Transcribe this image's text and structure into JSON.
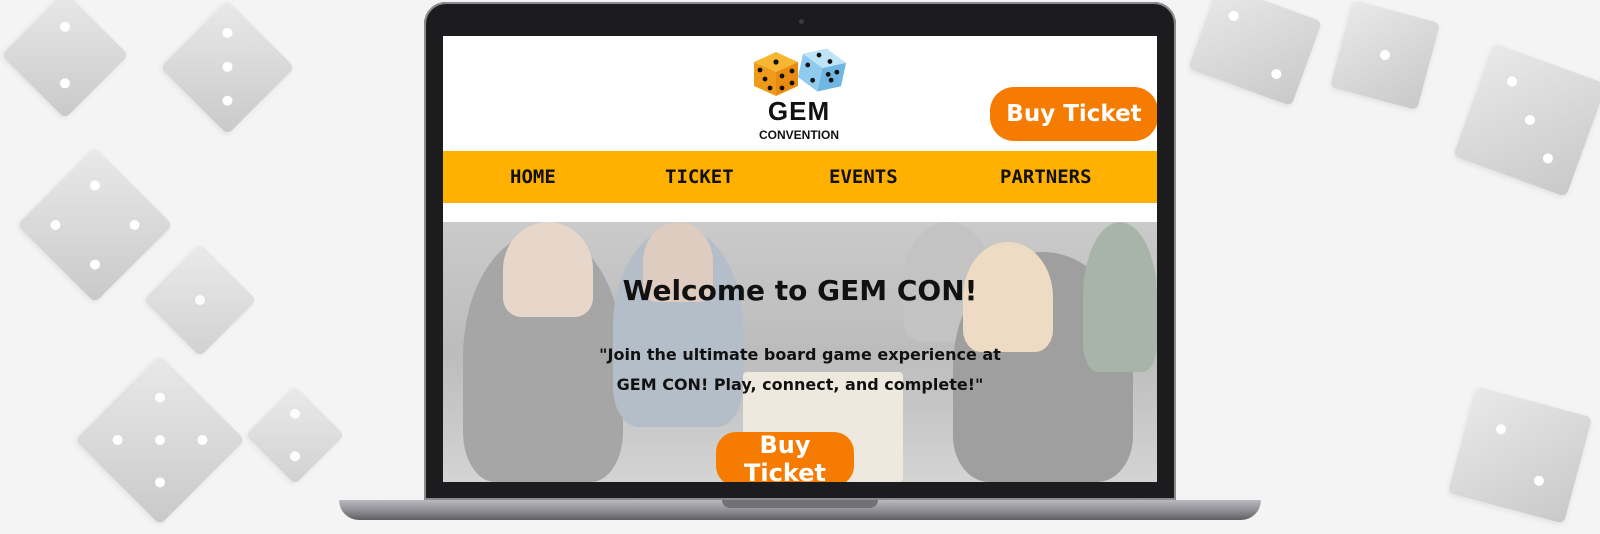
{
  "site": {
    "logo_title": "GEM",
    "logo_subtitle": "CONVENTION"
  },
  "header": {
    "buy_button_label": "Buy Ticket"
  },
  "nav": {
    "items": [
      {
        "label": "HOME"
      },
      {
        "label": "TICKET"
      },
      {
        "label": "EVENTS"
      },
      {
        "label": "PARTNERS"
      }
    ]
  },
  "hero": {
    "title": "Welcome to GEM CON!",
    "tagline": "\"Join the ultimate board game experience at GEM CON! Play, connect, and complete!\"",
    "buy_button_label": "Buy Ticket"
  },
  "colors": {
    "nav_background": "#ffb000",
    "button_background": "#f57c00",
    "button_text": "#ffffff"
  },
  "icons": {
    "logo": "dice-logo-icon",
    "background": "dice-pattern"
  }
}
